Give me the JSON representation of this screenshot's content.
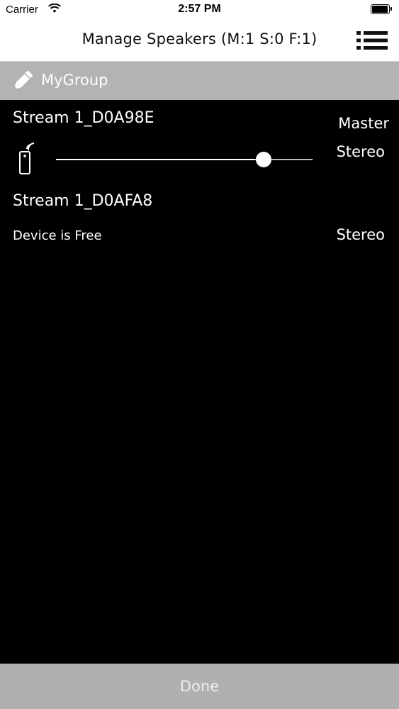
{
  "status_bar": {
    "carrier": "Carrier",
    "time": "2:57 PM"
  },
  "nav": {
    "title": "Manage Speakers (M:1 S:0 F:1)",
    "menu_icon": "list-menu-icon"
  },
  "group": {
    "name": "MyGroup",
    "icon": "pencil-icon"
  },
  "speakers": [
    {
      "name": "Stream 1_D0A98E",
      "role": "Master",
      "mode": "Stereo",
      "volume_fraction": 0.81,
      "icon": "remote-control-icon"
    },
    {
      "name": "Stream 1_D0AFA8",
      "status": "Device is Free",
      "mode": "Stereo"
    }
  ],
  "footer": {
    "done_label": "Done"
  },
  "colors": {
    "background": "#000000",
    "group_header": "#b3b3b3",
    "done_bar": "#b0b0b0",
    "text": "#ffffff"
  }
}
